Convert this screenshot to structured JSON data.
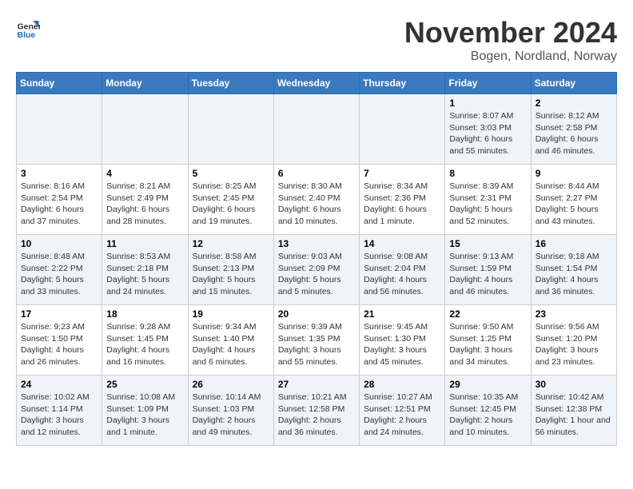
{
  "header": {
    "logo_line1": "General",
    "logo_line2": "Blue",
    "month": "November 2024",
    "location": "Bogen, Nordland, Norway"
  },
  "weekdays": [
    "Sunday",
    "Monday",
    "Tuesday",
    "Wednesday",
    "Thursday",
    "Friday",
    "Saturday"
  ],
  "weeks": [
    [
      {
        "day": "",
        "info": ""
      },
      {
        "day": "",
        "info": ""
      },
      {
        "day": "",
        "info": ""
      },
      {
        "day": "",
        "info": ""
      },
      {
        "day": "",
        "info": ""
      },
      {
        "day": "1",
        "info": "Sunrise: 8:07 AM\nSunset: 3:03 PM\nDaylight: 6 hours\nand 55 minutes."
      },
      {
        "day": "2",
        "info": "Sunrise: 8:12 AM\nSunset: 2:58 PM\nDaylight: 6 hours\nand 46 minutes."
      }
    ],
    [
      {
        "day": "3",
        "info": "Sunrise: 8:16 AM\nSunset: 2:54 PM\nDaylight: 6 hours\nand 37 minutes."
      },
      {
        "day": "4",
        "info": "Sunrise: 8:21 AM\nSunset: 2:49 PM\nDaylight: 6 hours\nand 28 minutes."
      },
      {
        "day": "5",
        "info": "Sunrise: 8:25 AM\nSunset: 2:45 PM\nDaylight: 6 hours\nand 19 minutes."
      },
      {
        "day": "6",
        "info": "Sunrise: 8:30 AM\nSunset: 2:40 PM\nDaylight: 6 hours\nand 10 minutes."
      },
      {
        "day": "7",
        "info": "Sunrise: 8:34 AM\nSunset: 2:36 PM\nDaylight: 6 hours\nand 1 minute."
      },
      {
        "day": "8",
        "info": "Sunrise: 8:39 AM\nSunset: 2:31 PM\nDaylight: 5 hours\nand 52 minutes."
      },
      {
        "day": "9",
        "info": "Sunrise: 8:44 AM\nSunset: 2:27 PM\nDaylight: 5 hours\nand 43 minutes."
      }
    ],
    [
      {
        "day": "10",
        "info": "Sunrise: 8:48 AM\nSunset: 2:22 PM\nDaylight: 5 hours\nand 33 minutes."
      },
      {
        "day": "11",
        "info": "Sunrise: 8:53 AM\nSunset: 2:18 PM\nDaylight: 5 hours\nand 24 minutes."
      },
      {
        "day": "12",
        "info": "Sunrise: 8:58 AM\nSunset: 2:13 PM\nDaylight: 5 hours\nand 15 minutes."
      },
      {
        "day": "13",
        "info": "Sunrise: 9:03 AM\nSunset: 2:09 PM\nDaylight: 5 hours\nand 5 minutes."
      },
      {
        "day": "14",
        "info": "Sunrise: 9:08 AM\nSunset: 2:04 PM\nDaylight: 4 hours\nand 56 minutes."
      },
      {
        "day": "15",
        "info": "Sunrise: 9:13 AM\nSunset: 1:59 PM\nDaylight: 4 hours\nand 46 minutes."
      },
      {
        "day": "16",
        "info": "Sunrise: 9:18 AM\nSunset: 1:54 PM\nDaylight: 4 hours\nand 36 minutes."
      }
    ],
    [
      {
        "day": "17",
        "info": "Sunrise: 9:23 AM\nSunset: 1:50 PM\nDaylight: 4 hours\nand 26 minutes."
      },
      {
        "day": "18",
        "info": "Sunrise: 9:28 AM\nSunset: 1:45 PM\nDaylight: 4 hours\nand 16 minutes."
      },
      {
        "day": "19",
        "info": "Sunrise: 9:34 AM\nSunset: 1:40 PM\nDaylight: 4 hours\nand 6 minutes."
      },
      {
        "day": "20",
        "info": "Sunrise: 9:39 AM\nSunset: 1:35 PM\nDaylight: 3 hours\nand 55 minutes."
      },
      {
        "day": "21",
        "info": "Sunrise: 9:45 AM\nSunset: 1:30 PM\nDaylight: 3 hours\nand 45 minutes."
      },
      {
        "day": "22",
        "info": "Sunrise: 9:50 AM\nSunset: 1:25 PM\nDaylight: 3 hours\nand 34 minutes."
      },
      {
        "day": "23",
        "info": "Sunrise: 9:56 AM\nSunset: 1:20 PM\nDaylight: 3 hours\nand 23 minutes."
      }
    ],
    [
      {
        "day": "24",
        "info": "Sunrise: 10:02 AM\nSunset: 1:14 PM\nDaylight: 3 hours\nand 12 minutes."
      },
      {
        "day": "25",
        "info": "Sunrise: 10:08 AM\nSunset: 1:09 PM\nDaylight: 3 hours\nand 1 minute."
      },
      {
        "day": "26",
        "info": "Sunrise: 10:14 AM\nSunset: 1:03 PM\nDaylight: 2 hours\nand 49 minutes."
      },
      {
        "day": "27",
        "info": "Sunrise: 10:21 AM\nSunset: 12:58 PM\nDaylight: 2 hours\nand 36 minutes."
      },
      {
        "day": "28",
        "info": "Sunrise: 10:27 AM\nSunset: 12:51 PM\nDaylight: 2 hours\nand 24 minutes."
      },
      {
        "day": "29",
        "info": "Sunrise: 10:35 AM\nSunset: 12:45 PM\nDaylight: 2 hours\nand 10 minutes."
      },
      {
        "day": "30",
        "info": "Sunrise: 10:42 AM\nSunset: 12:38 PM\nDaylight: 1 hour and\n56 minutes."
      }
    ]
  ]
}
